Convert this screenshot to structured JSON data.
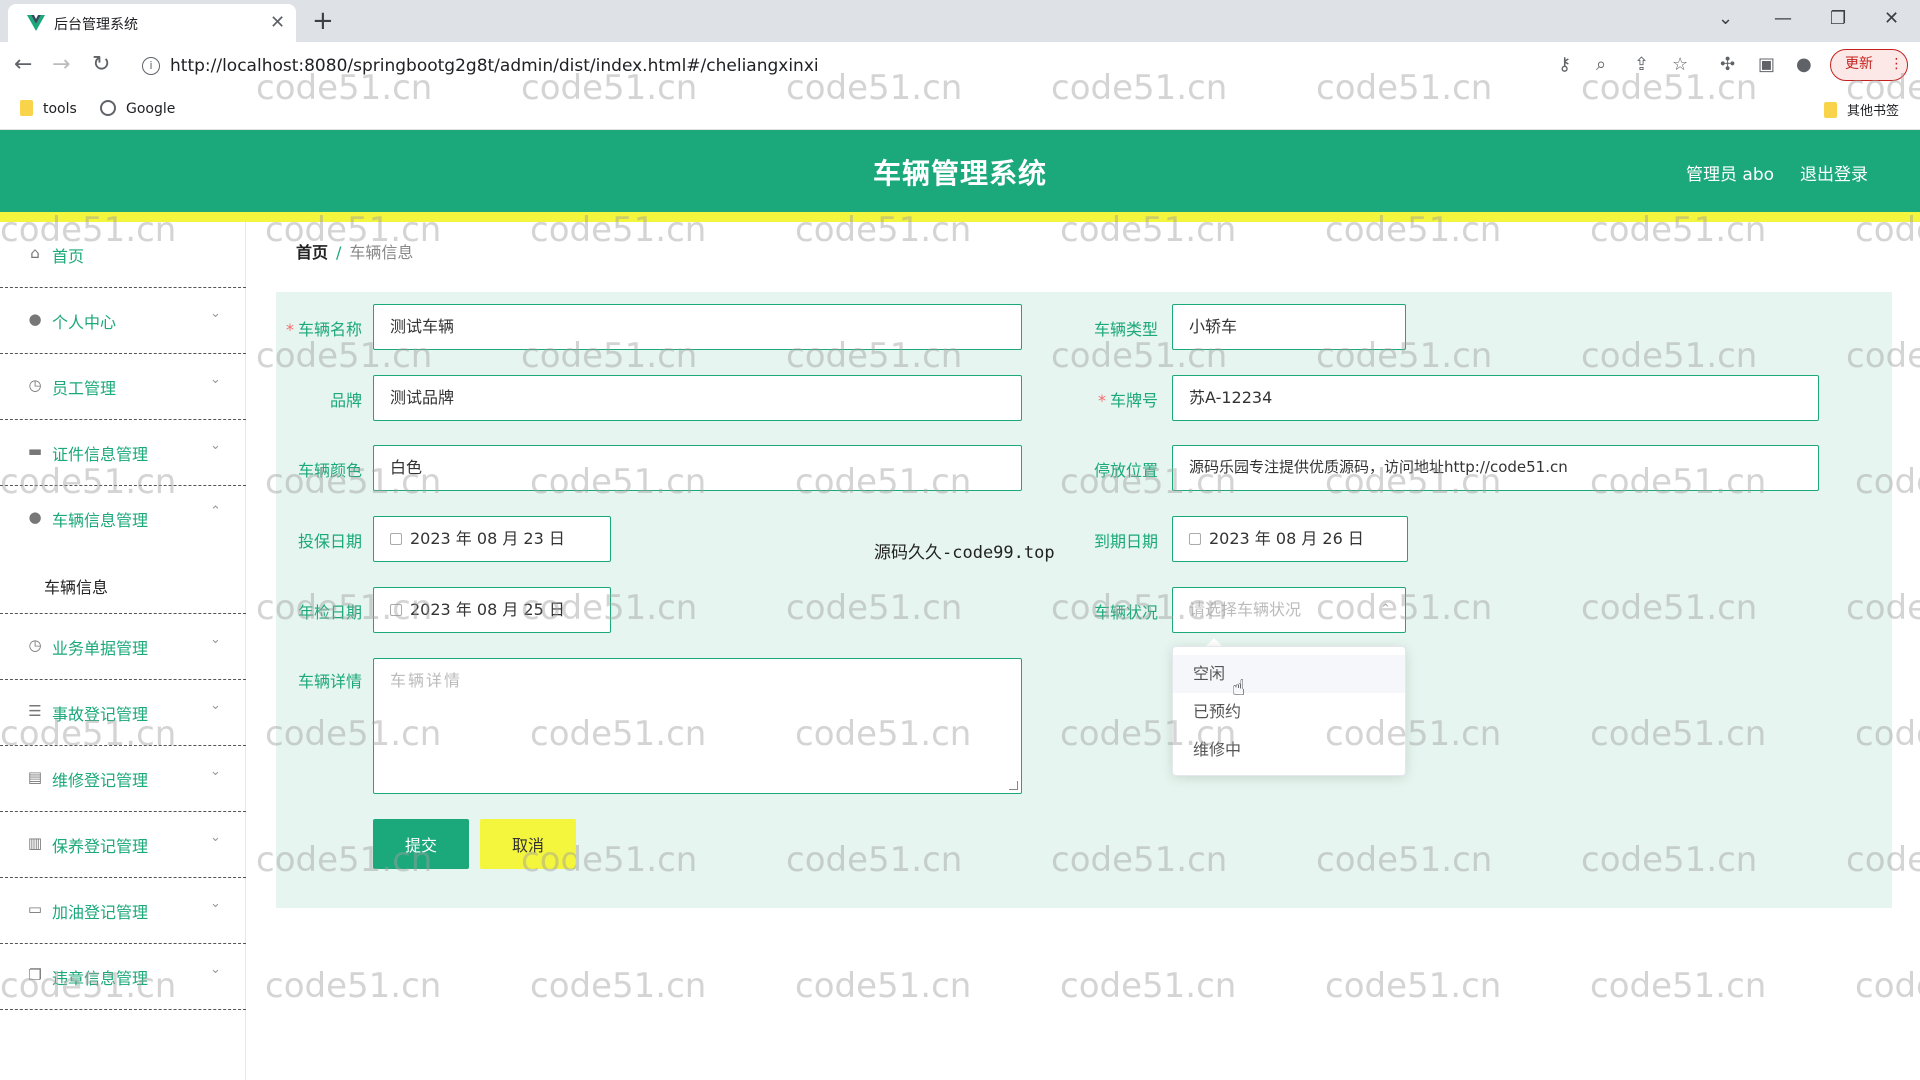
{
  "browser": {
    "tab_title": "后台管理系统",
    "url": "http://localhost:8080/springbootg2g8t/admin/dist/index.html#/cheliangxinxi",
    "update_label": "更新",
    "bookmarks": [
      "tools",
      "Google"
    ],
    "other_bookmarks": "其他书签"
  },
  "header": {
    "title": "车辆管理系统",
    "admin": "管理员 abo",
    "logout": "退出登录",
    "accent": "#1ba87a",
    "highlight": "#f4f53d"
  },
  "sidebar": {
    "items": [
      {
        "label": "首页",
        "icon": "home-icon"
      },
      {
        "label": "个人中心",
        "icon": "user-icon"
      },
      {
        "label": "员工管理",
        "icon": "clock-icon"
      },
      {
        "label": "证件信息管理",
        "icon": "card-icon"
      },
      {
        "label": "车辆信息管理",
        "icon": "user-icon"
      },
      {
        "label": "业务单据管理",
        "icon": "clock-icon"
      },
      {
        "label": "事故登记管理",
        "icon": "sliders-icon"
      },
      {
        "label": "维修登记管理",
        "icon": "briefcase-icon"
      },
      {
        "label": "保养登记管理",
        "icon": "chart-icon"
      },
      {
        "label": "加油登记管理",
        "icon": "chat-icon"
      },
      {
        "label": "违章信息管理",
        "icon": "copy-icon"
      }
    ],
    "submenu_active": "车辆信息"
  },
  "breadcrumb": {
    "home": "首页",
    "separator": "/",
    "current": "车辆信息"
  },
  "form": {
    "vehicle_name": {
      "label": "车辆名称",
      "value": "测试车辆"
    },
    "vehicle_type": {
      "label": "车辆类型",
      "value": "小轿车"
    },
    "brand": {
      "label": "品牌",
      "value": "测试品牌"
    },
    "plate": {
      "label": "车牌号",
      "value": "苏A-12234"
    },
    "color": {
      "label": "车辆颜色",
      "value": "白色"
    },
    "parking": {
      "label": "停放位置",
      "value": "源码乐园专注提供优质源码，访问地址http://code51.cn"
    },
    "insure_date": {
      "label": "投保日期",
      "value": "2023 年 08 月 23 日"
    },
    "expire_date": {
      "label": "到期日期",
      "value": "2023 年 08 月 26 日"
    },
    "inspect_date": {
      "label": "年检日期",
      "value": "2023 年 08 月 25 日"
    },
    "status": {
      "label": "车辆状况",
      "placeholder": "请选择车辆状况"
    },
    "details": {
      "label": "车辆详情",
      "placeholder": "车辆详情"
    },
    "submit": "提交",
    "cancel": "取消"
  },
  "status_options": [
    "空闲",
    "已预约",
    "维修中"
  ],
  "overlay_text": "源码久久-code99.top",
  "watermark": "code51.cn"
}
